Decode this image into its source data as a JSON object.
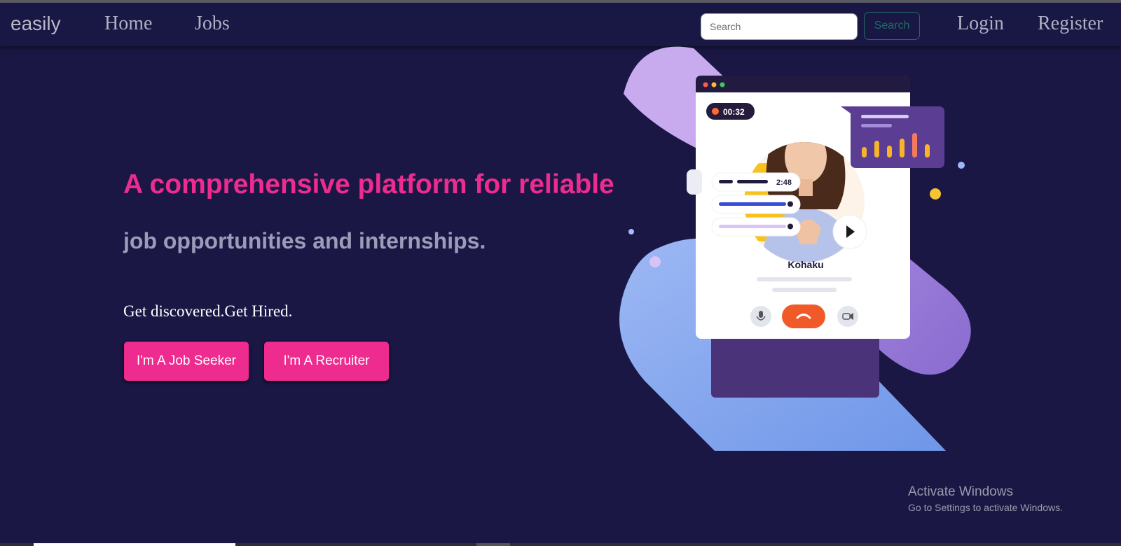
{
  "navbar": {
    "brand": "easily",
    "links": [
      "Home",
      "Jobs"
    ],
    "search_placeholder": "Search",
    "search_value": "",
    "search_button": "Search",
    "login": "Login",
    "register": "Register"
  },
  "hero": {
    "headline": "A comprehensive platform for reliable",
    "subline": "job opportunities and internships.",
    "tagline": "Get discovered.Get Hired.",
    "buttons": [
      "I'm A Job Seeker",
      "I'm A Recruiter"
    ]
  },
  "illustration": {
    "call_timer": "00:32",
    "message_duration": "2:48",
    "caller_name": "Kohaku",
    "colors": {
      "accent_pink": "#ee2b8f",
      "background": "#1a1745",
      "lavender": "#c5a8ee",
      "blue": "#7fa2ee",
      "purple": "#8f6fd4",
      "hangup": "#f05a28"
    }
  },
  "watermark": {
    "title": "Activate Windows",
    "subtitle": "Go to Settings to activate Windows."
  }
}
